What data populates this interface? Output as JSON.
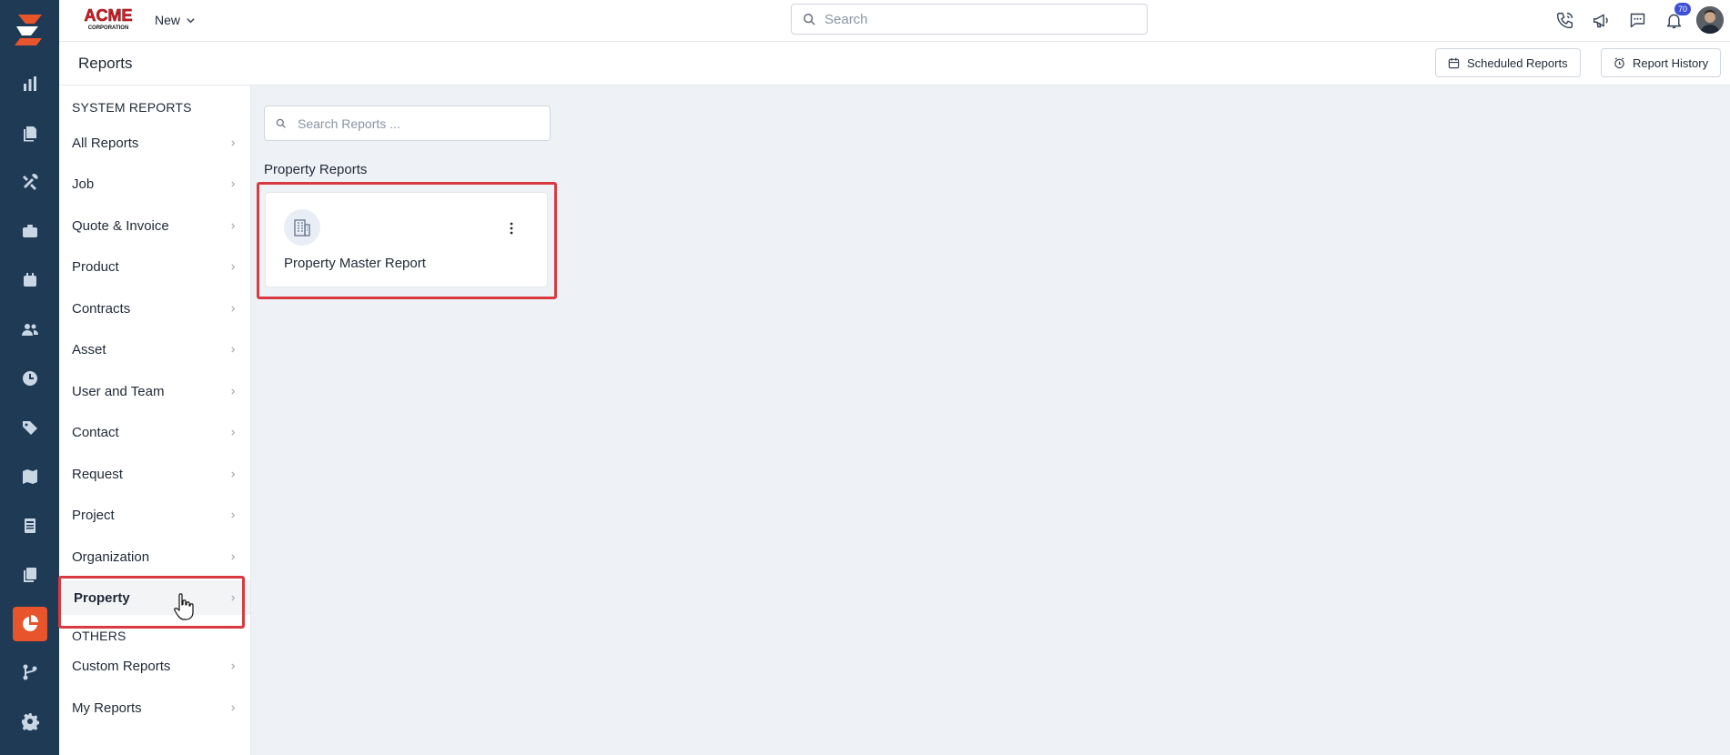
{
  "brand": {
    "logo_text": "ACME",
    "logo_sub": "CORPORATION"
  },
  "topbar": {
    "new_label": "New",
    "search_placeholder": "Search",
    "icons": [
      "phone-icon",
      "megaphone-icon",
      "chat-icon",
      "bell-icon"
    ],
    "notification_count": "70"
  },
  "header": {
    "title": "Reports",
    "scheduled_reports_label": "Scheduled Reports",
    "report_history_label": "Report History"
  },
  "sidebar": {
    "system_title": "SYSTEM REPORTS",
    "system_items": [
      {
        "label": "All Reports"
      },
      {
        "label": "Job"
      },
      {
        "label": "Quote & Invoice"
      },
      {
        "label": "Product"
      },
      {
        "label": "Contracts"
      },
      {
        "label": "Asset"
      },
      {
        "label": "User and Team"
      },
      {
        "label": "Contact"
      },
      {
        "label": "Request"
      },
      {
        "label": "Project"
      },
      {
        "label": "Organization"
      },
      {
        "label": "Property"
      }
    ],
    "others_title": "OTHERS",
    "other_items": [
      {
        "label": "Custom Reports"
      },
      {
        "label": "My Reports"
      }
    ],
    "active_item": "Property"
  },
  "main": {
    "search_placeholder": "Search Reports ...",
    "group_title": "Property Reports",
    "cards": [
      {
        "title": "Property Master Report",
        "icon": "building-icon"
      }
    ]
  },
  "rail": {
    "items": [
      "dashboard-icon",
      "documents-icon",
      "tools-icon",
      "briefcase-icon",
      "calendar-icon",
      "users-icon",
      "clock-icon",
      "tag-icon",
      "map-icon",
      "invoice-icon",
      "copy-icon",
      "reports-icon",
      "workflow-icon",
      "settings-icon"
    ],
    "active": "reports-icon"
  },
  "colors": {
    "rail_bg": "#1e3a55",
    "accent": "#e8542b",
    "highlight": "#d83a3f",
    "badge": "#3b4fd8"
  }
}
